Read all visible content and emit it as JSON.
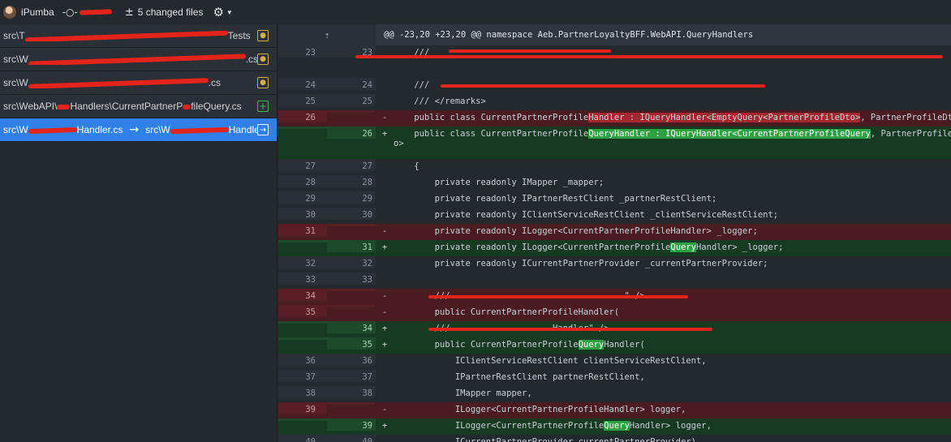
{
  "toolbar": {
    "user": "iPumba",
    "changed_files": "5 changed files"
  },
  "sidebar": {
    "files": [
      {
        "path_start": "src\\T",
        "path_end": "Tests",
        "status": "modified",
        "selected": false
      },
      {
        "path_start": "src\\W",
        "path_end": ".cs",
        "status": "modified",
        "selected": false
      },
      {
        "path_start": "src\\W",
        "path_end": ".cs",
        "status": "modified",
        "selected": false
      },
      {
        "path_start": "src\\WebAPI\\",
        "path_mid": "Handlers\\CurrentPartnerP",
        "path_end": "fileQuery.cs",
        "status": "added",
        "selected": false
      },
      {
        "path_start": "src\\W",
        "path_mid": "Handler.cs",
        "arrow": "→",
        "path_new": "src\\W",
        "path_end": "Handler.cs",
        "status": "renamed",
        "selected": true
      }
    ]
  },
  "diff": {
    "hunk_header": "@@ -23,20 +23,20 @@ namespace Aeb.PartnerLoyaltyBFF.WebAPI.QueryHandlers",
    "lines": [
      {
        "old": "23",
        "new": "23",
        "sign": "",
        "type": "ctx",
        "code": "    ///      ",
        "tall": true
      },
      {
        "old": "24",
        "new": "24",
        "sign": "",
        "type": "ctx",
        "code": "    ///      "
      },
      {
        "old": "25",
        "new": "25",
        "sign": "",
        "type": "ctx",
        "code": "    /// </remarks>"
      },
      {
        "old": "26",
        "new": "",
        "sign": "-",
        "type": "del",
        "code_a": "    public class CurrentPartnerProfile",
        "code_hl": "Handler : IQueryHandler<EmptyQuery<PartnerProfileDto>",
        "code_b": ", PartnerProfileDto>"
      },
      {
        "old": "",
        "new": "26",
        "sign": "+",
        "type": "add",
        "code_a": "    public class CurrentPartnerProfile",
        "code_hl": "QueryHandler : IQueryHandler<CurrentPartnerProfileQuery",
        "code_b": ", PartnerProfileDt",
        "code_wrap": "o>",
        "tall": true
      },
      {
        "old": "27",
        "new": "27",
        "sign": "",
        "type": "ctx",
        "code": "    {"
      },
      {
        "old": "28",
        "new": "28",
        "sign": "",
        "type": "ctx",
        "code": "        private readonly IMapper _mapper;"
      },
      {
        "old": "29",
        "new": "29",
        "sign": "",
        "type": "ctx",
        "code": "        private readonly IPartnerRestClient _partnerRestClient;"
      },
      {
        "old": "30",
        "new": "30",
        "sign": "",
        "type": "ctx",
        "code": "        private readonly IClientServiceRestClient _clientServiceRestClient;"
      },
      {
        "old": "31",
        "new": "",
        "sign": "-",
        "type": "del",
        "code": "        private readonly ILogger<CurrentPartnerProfileHandler> _logger;"
      },
      {
        "old": "",
        "new": "31",
        "sign": "+",
        "type": "add",
        "code_a": "        private readonly ILogger<CurrentPartnerProfile",
        "code_hl": "Query",
        "code_b": "Handler> _logger;"
      },
      {
        "old": "32",
        "new": "32",
        "sign": "",
        "type": "ctx",
        "code": "        private readonly ICurrentPartnerProvider _currentPartnerProvider;"
      },
      {
        "old": "33",
        "new": "33",
        "sign": "",
        "type": "ctx",
        "code": ""
      },
      {
        "old": "34",
        "new": "",
        "sign": "-",
        "type": "del",
        "code": "        ///                                  \" />"
      },
      {
        "old": "35",
        "new": "",
        "sign": "-",
        "type": "del",
        "code": "        public CurrentPartnerProfileHandler("
      },
      {
        "old": "",
        "new": "34",
        "sign": "+",
        "type": "add",
        "code": "        ///                    Handler\" />"
      },
      {
        "old": "",
        "new": "35",
        "sign": "+",
        "type": "add",
        "code_a": "        public CurrentPartnerProfile",
        "code_hl": "Query",
        "code_b": "Handler("
      },
      {
        "old": "36",
        "new": "36",
        "sign": "",
        "type": "ctx",
        "code": "            IClientServiceRestClient clientServiceRestClient,"
      },
      {
        "old": "37",
        "new": "37",
        "sign": "",
        "type": "ctx",
        "code": "            IPartnerRestClient partnerRestClient,"
      },
      {
        "old": "38",
        "new": "38",
        "sign": "",
        "type": "ctx",
        "code": "            IMapper mapper,"
      },
      {
        "old": "39",
        "new": "",
        "sign": "-",
        "type": "del",
        "code": "            ILogger<CurrentPartnerProfileHandler> logger,"
      },
      {
        "old": "",
        "new": "39",
        "sign": "+",
        "type": "add",
        "code_a": "            ILogger<CurrentPartnerProfile",
        "code_hl": "Query",
        "code_b": "Handler> logger,"
      },
      {
        "old": "40",
        "new": "40",
        "sign": "",
        "type": "ctx",
        "code": "            ICurrentPartnerProvider currentPartnerProvider)"
      }
    ]
  },
  "icons": {
    "commit": "commit-icon",
    "plusminus": "plus-minus-icon",
    "settings": "gear-icon",
    "expand": "expand-up-icon"
  }
}
